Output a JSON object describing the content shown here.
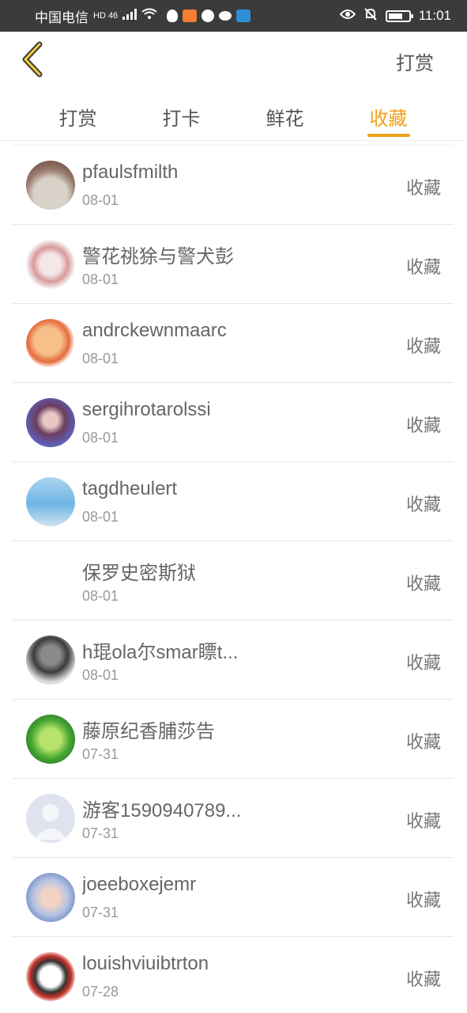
{
  "status_bar": {
    "carrier": "中国电信",
    "network": "HD 46",
    "time": "11:01"
  },
  "header": {
    "back_icon": "chevron-left-icon",
    "right_label": "打赏",
    "accent_color": "#f0a11b"
  },
  "tabs": [
    {
      "label": "打赏",
      "active": false
    },
    {
      "label": "打卡",
      "active": false
    },
    {
      "label": "鲜花",
      "active": false
    },
    {
      "label": "收藏",
      "active": true
    }
  ],
  "list": [
    {
      "name": "pfaulsfmilth",
      "date": "08-01",
      "action": "收藏"
    },
    {
      "name": "警花祧狳与警犬彭",
      "date": "08-01",
      "action": "收藏"
    },
    {
      "name": "andrckewnmaarc",
      "date": "08-01",
      "action": "收藏"
    },
    {
      "name": "sergihrotarolssi",
      "date": "08-01",
      "action": "收藏"
    },
    {
      "name": "tagdheulert",
      "date": "08-01",
      "action": "收藏"
    },
    {
      "name": "保罗史密斯狱",
      "date": "08-01",
      "action": "收藏"
    },
    {
      "name": "h琨ola尔smar瞟t...",
      "date": "08-01",
      "action": "收藏"
    },
    {
      "name": "藤原纪香脯莎告",
      "date": "07-31",
      "action": "收藏"
    },
    {
      "name": "游客1590940789...",
      "date": "07-31",
      "action": "收藏"
    },
    {
      "name": "joeeboxejemr",
      "date": "07-31",
      "action": "收藏"
    },
    {
      "name": "louishviuibtrton",
      "date": "07-28",
      "action": "收藏"
    }
  ]
}
